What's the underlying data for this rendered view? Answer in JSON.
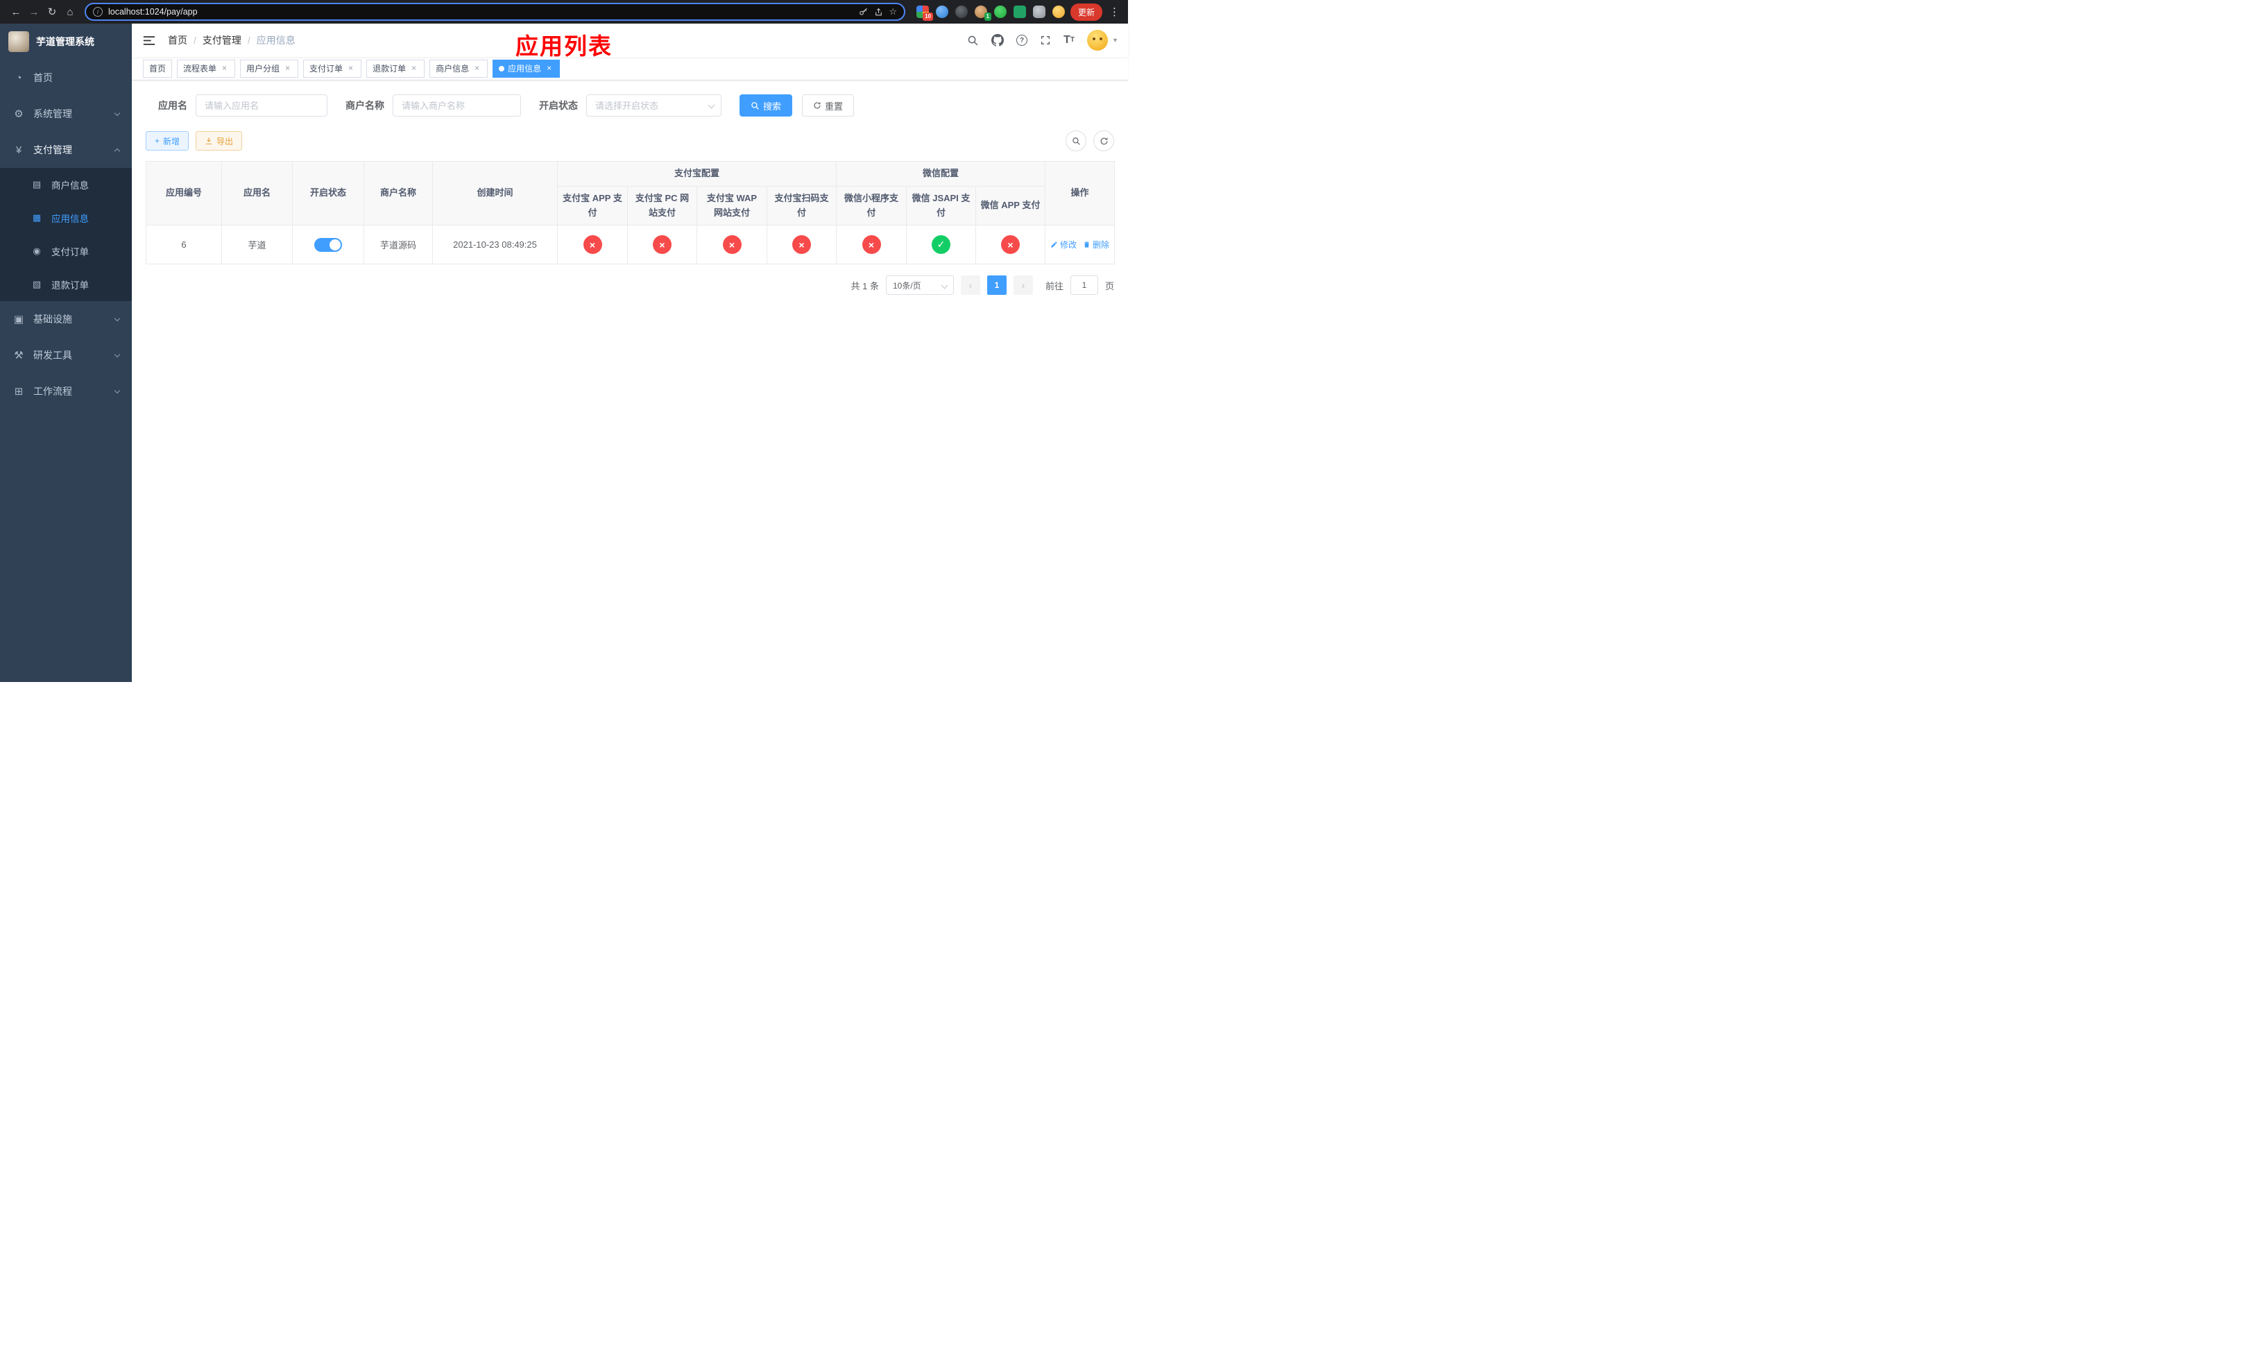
{
  "colors": {
    "primary": "#409eff",
    "danger": "#f74b4b",
    "success": "#13ce66",
    "warning": "#e6a23c",
    "annotation": "#ff0000",
    "sidebar_bg": "#304156",
    "submenu_bg": "#1f2d3d"
  },
  "icons": {
    "back": "←",
    "forward": "→",
    "reload": "↻",
    "chrome_home": "⌂",
    "star": "☆",
    "menu_dots": "⋮",
    "info": "i",
    "home": "◔",
    "system": "⚙",
    "payment": "¥",
    "merchant": "▤",
    "app": "▦",
    "pay_order": "◉",
    "refund_order": "▧",
    "infra": "▣",
    "devtool": "⚒",
    "workflow": "⊞",
    "close": "×",
    "plus": "+",
    "question": "?",
    "caret": "▾",
    "font_large": "T",
    "font_small": "T",
    "prev": "‹",
    "next": "›"
  },
  "browser": {
    "url": "localhost:1024/pay/app",
    "update_button": "更新",
    "extension_badge": "10",
    "profile_badge": "1"
  },
  "sidebar": {
    "app_title": "芋道管理系统",
    "menu": [
      {
        "label": "首页"
      },
      {
        "label": "系统管理"
      },
      {
        "label": "支付管理"
      },
      {
        "label": "基础设施"
      },
      {
        "label": "研发工具"
      },
      {
        "label": "工作流程"
      }
    ],
    "payment_submenu": [
      {
        "label": "商户信息"
      },
      {
        "label": "应用信息"
      },
      {
        "label": "支付订单"
      },
      {
        "label": "退款订单"
      }
    ]
  },
  "header": {
    "breadcrumb": [
      "首页",
      "支付管理",
      "应用信息"
    ],
    "annotation_title": "应用列表"
  },
  "tags": [
    {
      "label": "首页"
    },
    {
      "label": "流程表单"
    },
    {
      "label": "用户分组"
    },
    {
      "label": "支付订单"
    },
    {
      "label": "退款订单"
    },
    {
      "label": "商户信息"
    },
    {
      "label": "应用信息"
    }
  ],
  "filters": {
    "app_name_label": "应用名",
    "app_name_placeholder": "请输入应用名",
    "merchant_label": "商户名称",
    "merchant_placeholder": "请输入商户名称",
    "status_label": "开启状态",
    "status_placeholder": "请选择开启状态",
    "search_button": "搜索",
    "reset_button": "重置"
  },
  "toolbar": {
    "add_button": "新增",
    "export_button": "导出"
  },
  "table": {
    "headers": {
      "app_id": "应用编号",
      "app_name": "应用名",
      "status": "开启状态",
      "merchant": "商户名称",
      "created": "创建时间",
      "alipay_group": "支付宝配置",
      "wechat_group": "微信配置",
      "alipay_app": "支付宝 APP 支付",
      "alipay_pc": "支付宝 PC 网站支付",
      "alipay_wap": "支付宝 WAP 网站支付",
      "alipay_qr": "支付宝扫码支付",
      "wx_mini": "微信小程序支付",
      "wx_jsapi": "微信 JSAPI 支付",
      "wx_app": "微信 APP 支付",
      "actions": "操作"
    },
    "row": {
      "app_id": "6",
      "app_name": "芋道",
      "enabled": true,
      "merchant": "芋道源码",
      "created": "2021-10-23 08:49:25",
      "statuses": {
        "alipay_app": false,
        "alipay_pc": false,
        "alipay_wap": false,
        "alipay_qr": false,
        "wx_mini": false,
        "wx_jsapi": true,
        "wx_app": false
      },
      "edit_label": "修改",
      "delete_label": "删除"
    }
  },
  "pagination": {
    "total_text": "共 1 条",
    "page_size": "10条/页",
    "current_page": "1",
    "goto_label": "前往",
    "goto_value": "1",
    "unit_label": "页"
  }
}
